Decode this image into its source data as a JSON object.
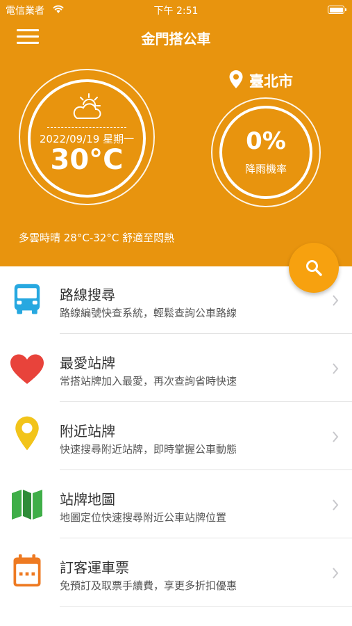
{
  "status_bar": {
    "carrier": "電信業者",
    "time": "下午 2:51"
  },
  "app": {
    "title": "金門搭公車"
  },
  "weather": {
    "date": "2022/09/19 星期一",
    "temperature": "30°C",
    "location": "臺北市",
    "rain_probability": "0%",
    "rain_label": "降雨機率",
    "description": "多雲時晴 28°C-32°C 舒適至悶熱",
    "icon": "partly-cloudy-icon"
  },
  "colors": {
    "header": "#E8940E",
    "fab": "#F7A10F",
    "bus": "#27A8E0",
    "heart": "#E8433B",
    "pin": "#F2C41A",
    "map": "#3FAE48",
    "calendar": "#EE7A22"
  },
  "menu": [
    {
      "title": "路線搜尋",
      "subtitle": "路線編號快查系統，輕鬆查詢公車路線",
      "icon": "bus-icon"
    },
    {
      "title": "最愛站牌",
      "subtitle": "常搭站牌加入最愛，再次查詢省時快速",
      "icon": "heart-icon"
    },
    {
      "title": "附近站牌",
      "subtitle": "快速搜尋附近站牌，即時掌握公車動態",
      "icon": "location-pin-icon"
    },
    {
      "title": "站牌地圖",
      "subtitle": "地圖定位快速搜尋附近公車站牌位置",
      "icon": "map-icon"
    },
    {
      "title": "訂客運車票",
      "subtitle": "免預訂及取票手續費，享更多折扣優惠",
      "icon": "calendar-icon"
    }
  ]
}
